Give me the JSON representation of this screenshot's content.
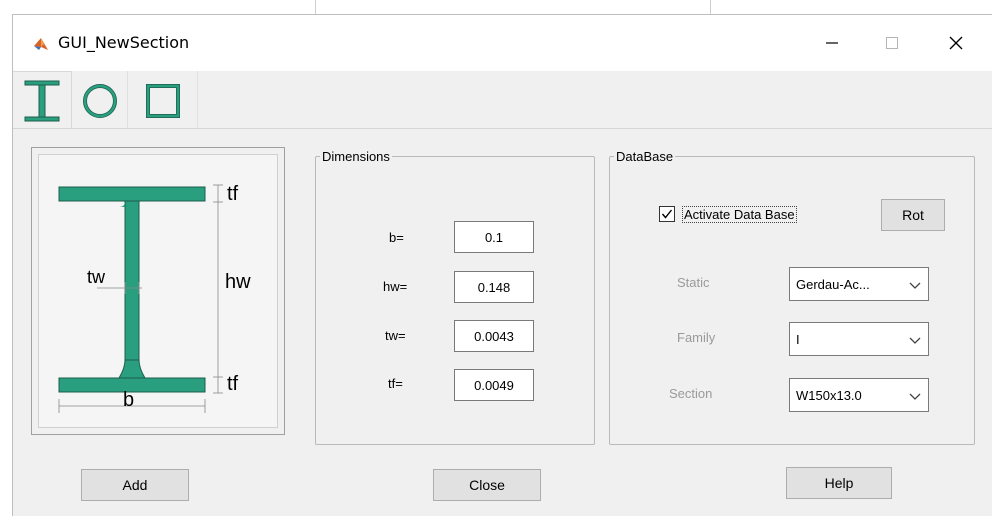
{
  "window": {
    "title": "GUI_NewSection",
    "minimize_icon": "minimize-icon",
    "maximize_icon": "maximize-icon",
    "close_icon": "close-icon"
  },
  "tabs": [
    {
      "icon": "i-beam-icon",
      "active": true
    },
    {
      "icon": "circle-icon",
      "active": false
    },
    {
      "icon": "square-icon",
      "active": false
    }
  ],
  "preview": {
    "labels": {
      "tf_top": "tf",
      "hw": "hw",
      "tw": "tw",
      "tf_bottom": "tf",
      "b": "b"
    },
    "fill_color": "#2a9f80"
  },
  "dimensions": {
    "legend": "Dimensions",
    "rows": [
      {
        "label": "b=",
        "value": "0.1"
      },
      {
        "label": "hw=",
        "value": "0.148"
      },
      {
        "label": "tw=",
        "value": "0.0043"
      },
      {
        "label": "tf=",
        "value": "0.0049"
      }
    ]
  },
  "database": {
    "legend": "DataBase",
    "activate_label": "Activate Data Base",
    "activate_checked": true,
    "rot_label": "Rot",
    "static_label": "Static",
    "static_value": "Gerdau-Ac...",
    "family_label": "Family",
    "family_value": "I",
    "section_label": "Section",
    "section_value": "W150x13.0"
  },
  "buttons": {
    "add": "Add",
    "close": "Close",
    "help": "Help"
  }
}
